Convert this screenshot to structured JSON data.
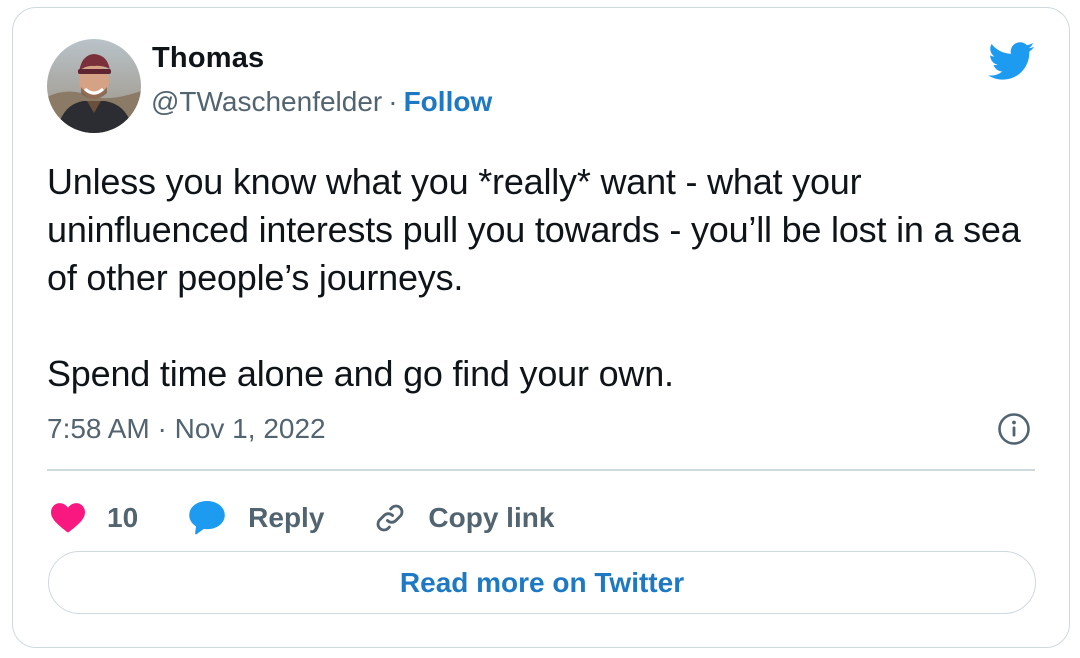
{
  "author": {
    "display_name": "Thomas",
    "handle": "@TWaschenfelder",
    "separator": "·",
    "follow_label": "Follow",
    "avatar_icon": "user-avatar-photo"
  },
  "brand": {
    "logo_icon": "twitter-bird-icon",
    "color": "#1d9bf0",
    "link_color": "#1d79c4"
  },
  "tweet": {
    "paragraphs": [
      "Unless you know what you *really* want - what your uninfluenced interests pull you towards - you’ll be lost in a sea of other people’s journeys.",
      "Spend time alone and go find your own."
    ],
    "timestamp": "7:58 AM · Nov 1, 2022"
  },
  "actions": {
    "like_count": "10",
    "like_color": "#f91880",
    "reply_label": "Reply",
    "reply_color": "#1d9bf0",
    "copy_link_label": "Copy link"
  },
  "footer": {
    "read_more_label": "Read more on Twitter"
  }
}
